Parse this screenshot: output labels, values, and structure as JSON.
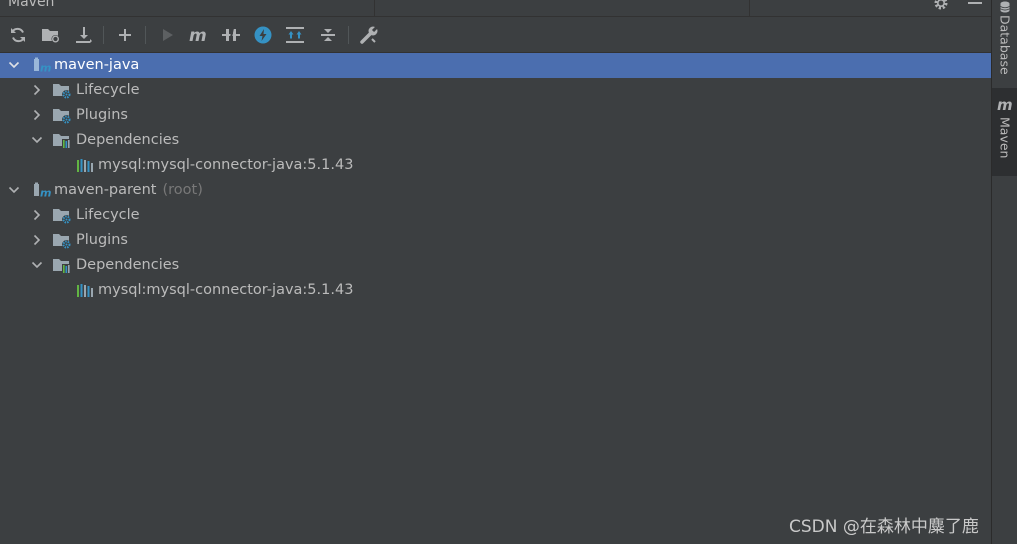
{
  "window": {
    "title": "Maven"
  },
  "toolbar": {
    "buttons": [
      {
        "name": "reload-all-projects-button",
        "icon": "refresh-icon"
      },
      {
        "name": "generate-sources-button",
        "icon": "folder-refresh-icon"
      },
      {
        "name": "download-sources-button",
        "icon": "download-icon"
      },
      {
        "name": "add-maven-project-button",
        "icon": "plus-icon"
      },
      {
        "name": "run-build-button",
        "icon": "play-icon"
      },
      {
        "name": "execute-goal-button",
        "icon": "maven-m-icon"
      },
      {
        "name": "toggle-offline-button",
        "icon": "offline-icon"
      },
      {
        "name": "skip-tests-button",
        "icon": "lightning-icon"
      },
      {
        "name": "show-dependencies-button",
        "icon": "expand-icon"
      },
      {
        "name": "collapse-all-button",
        "icon": "collapse-icon"
      },
      {
        "name": "maven-settings-button",
        "icon": "wrench-icon"
      }
    ]
  },
  "tree": {
    "project1": {
      "name": "maven-java",
      "lifecycle": "Lifecycle",
      "plugins": "Plugins",
      "dependencies": "Dependencies",
      "dependency": "mysql:mysql-connector-java:5.1.43"
    },
    "project2": {
      "name": "maven-parent",
      "suffix": "(root)",
      "lifecycle": "Lifecycle",
      "plugins": "Plugins",
      "dependencies": "Dependencies",
      "dependency": "mysql:mysql-connector-java:5.1.43"
    }
  },
  "right_strip": {
    "database_tab": "Database",
    "maven_tab": "Maven"
  },
  "watermark": "CSDN @在森林中麋了鹿",
  "colors": {
    "background": "#3c3f41",
    "selection": "#4b6eaf",
    "text": "#bbbbbb",
    "accent_blue": "#3592c4"
  }
}
